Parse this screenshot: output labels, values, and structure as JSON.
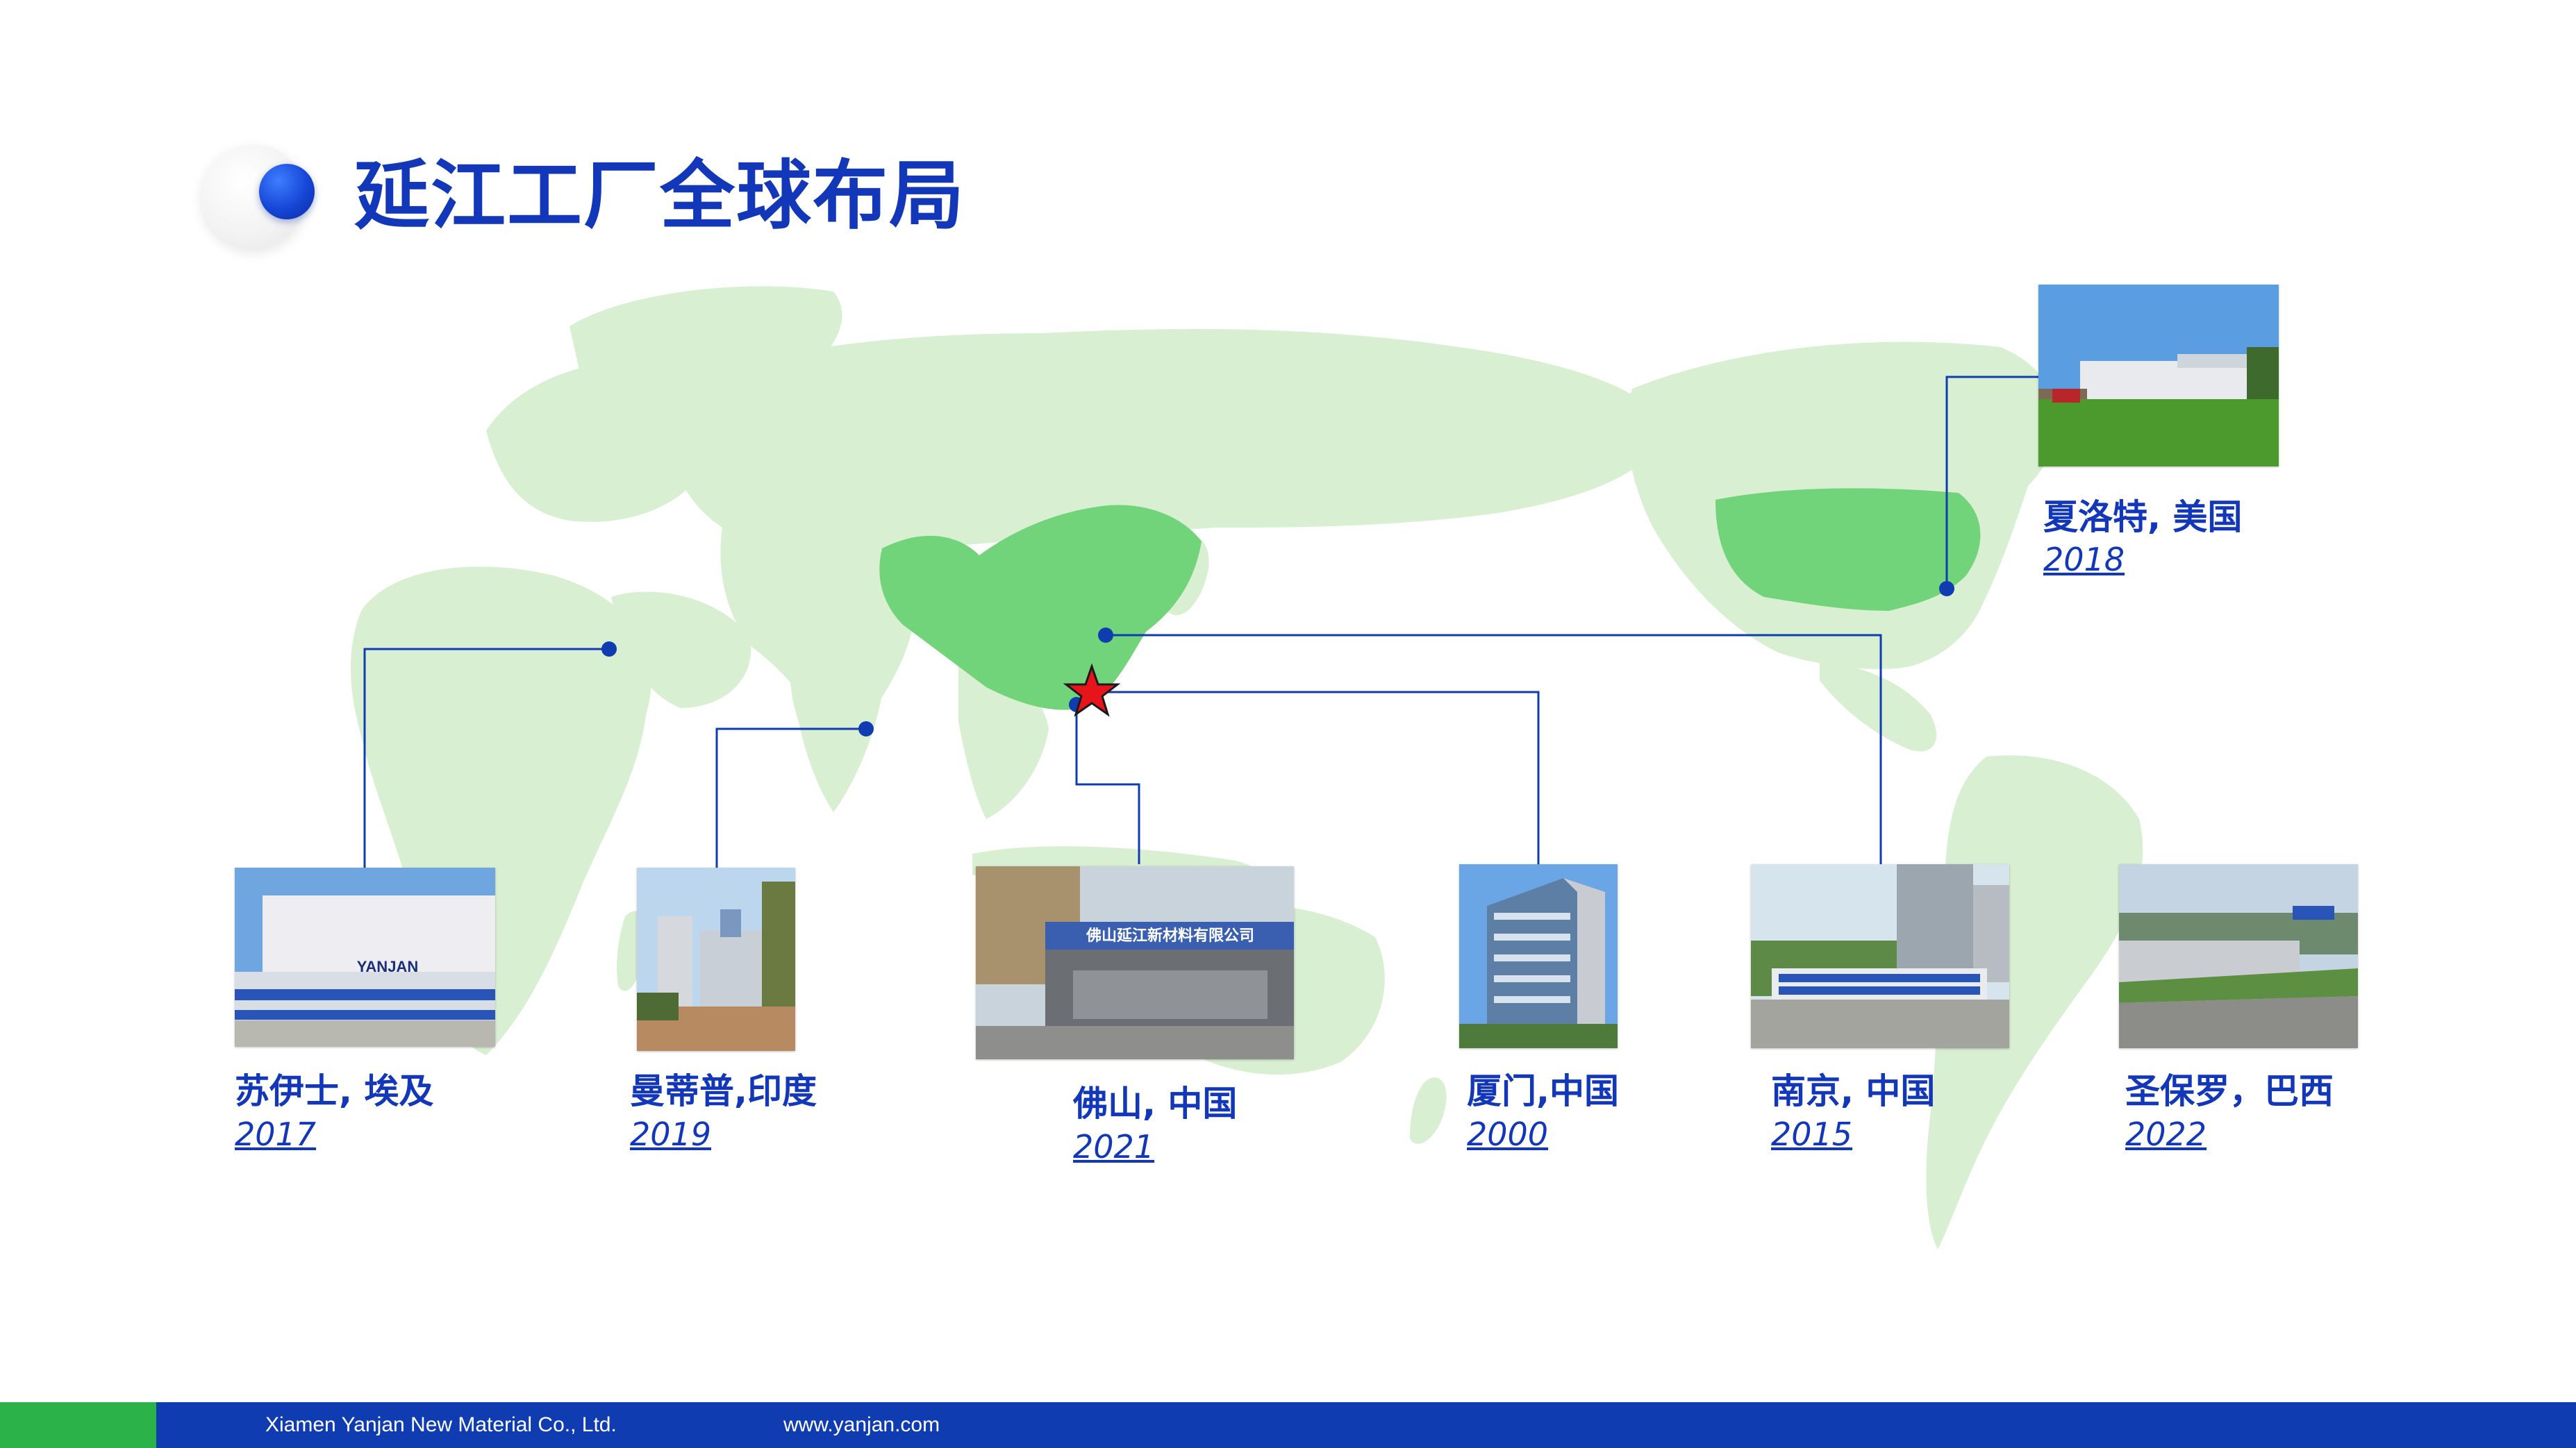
{
  "header": {
    "title": "延江工厂全球布局"
  },
  "locations": [
    {
      "id": "suez",
      "name": "苏伊士, 埃及",
      "year": "2017"
    },
    {
      "id": "mumbai",
      "name": "曼蒂普,印度",
      "year": "2019"
    },
    {
      "id": "foshan",
      "name": "佛山, 中国",
      "year": "2021"
    },
    {
      "id": "xiamen",
      "name": "厦门,中国",
      "year": "2000"
    },
    {
      "id": "nanjing",
      "name": "南京, 中国",
      "year": "2015"
    },
    {
      "id": "saopaulo",
      "name": "圣保罗，巴西",
      "year": "2022"
    },
    {
      "id": "charlotte",
      "name": "夏洛特, 美国",
      "year": "2018"
    }
  ],
  "photo_signs": {
    "suez_logo": "YANJAN",
    "foshan_sign": "佛山延江新材料有限公司"
  },
  "footer": {
    "company": "Xiamen Yanjan New Material Co., Ltd.",
    "website": "www.yanjan.com"
  },
  "colors": {
    "brand_blue": "#1237b8",
    "map_land": "#d8efd2",
    "map_highlight": "#72d47a",
    "connector": "#0f3cb0",
    "footer_green": "#2bb34a",
    "headquarters_star": "#e8141c"
  }
}
